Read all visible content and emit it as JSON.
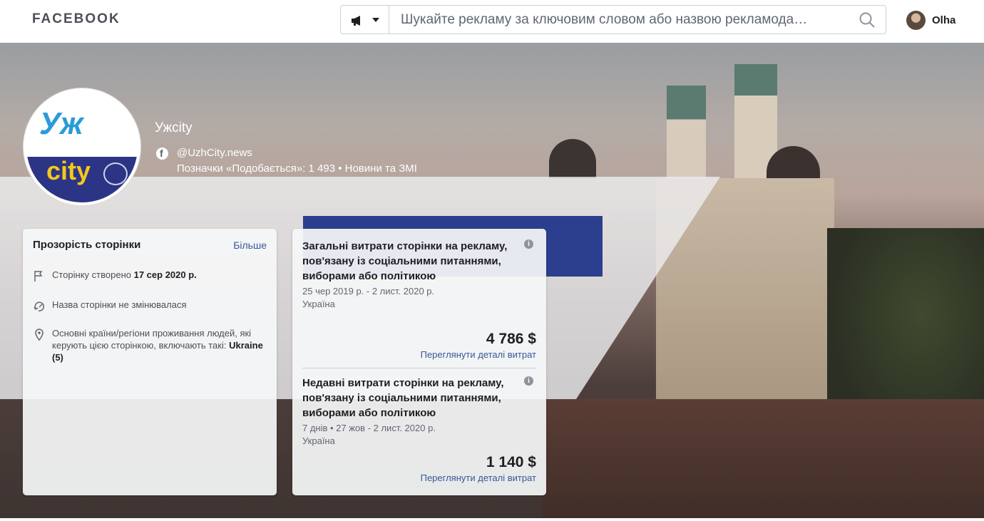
{
  "topbar": {
    "brand": "FACEBOOK",
    "search_placeholder": "Шукайте рекламу за ключовим словом або назвою рекламода…",
    "user_name": "Olha"
  },
  "page": {
    "name": "Ужсity",
    "handle": "@UzhCity.news",
    "likes_line": "Позначки «Подобається»: 1 493 • Новини та ЗМІ",
    "logo_text_top": "Уж",
    "logo_text_bottom": "city"
  },
  "transparency": {
    "title": "Прозорість сторінки",
    "more_label": "Більше",
    "created_label": "Сторінку створено",
    "created_date": "17 сер 2020 р.",
    "name_unchanged": "Назва сторінки не змінювалася",
    "countries_text": "Основні країни/регіони проживання людей, які керують цією сторінкою, включають такі:",
    "countries_value": "Ukraine (5)"
  },
  "spend": {
    "total": {
      "title": "Загальні витрати сторінки на рекламу, пов'язану із соціальними питаннями, виборами або політикою",
      "dates": "25 чер 2019 р. - 2 лист. 2020 р.",
      "country": "Україна",
      "amount": "4 786 $",
      "details_link": "Переглянути деталі витрат"
    },
    "recent": {
      "title": "Недавні витрати сторінки на рекламу, пов'язану із соціальними питаннями, виборами або політикою",
      "dates": "7 днів • 27 жов - 2 лист. 2020 р.",
      "country": "Україна",
      "amount": "1 140 $",
      "details_link": "Переглянути деталі витрат"
    }
  }
}
